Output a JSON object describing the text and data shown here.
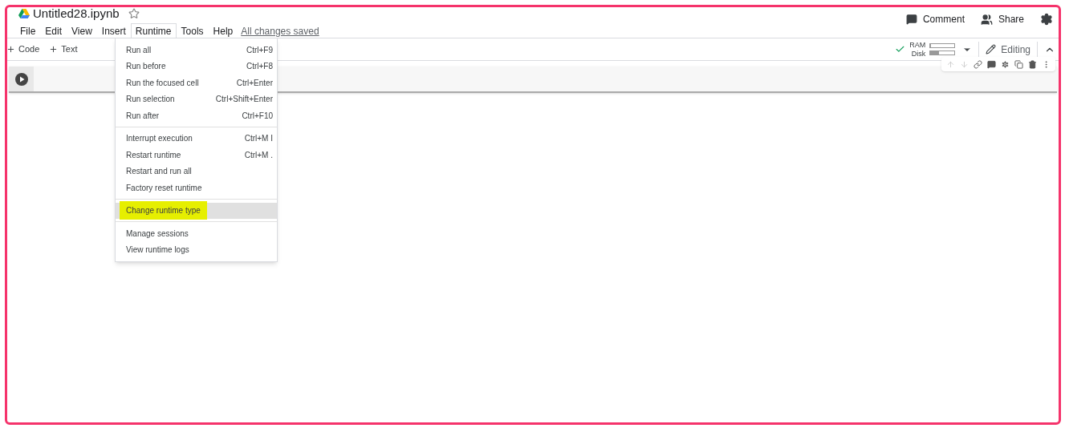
{
  "notebook": {
    "title": "Untitled28.ipynb",
    "starred": false
  },
  "menubar": [
    {
      "label": "File",
      "selected": false
    },
    {
      "label": "Edit",
      "selected": false
    },
    {
      "label": "View",
      "selected": false
    },
    {
      "label": "Insert",
      "selected": false
    },
    {
      "label": "Runtime",
      "selected": true
    },
    {
      "label": "Tools",
      "selected": false
    },
    {
      "label": "Help",
      "selected": false
    }
  ],
  "save_status": "All changes saved",
  "header_actions": [
    "Comment",
    "Share"
  ],
  "toolbar": {
    "add_buttons": [
      "Code",
      "Text"
    ],
    "resources": [
      {
        "label": "RAM",
        "level": 0.02
      },
      {
        "label": "Disk",
        "level": 0.35
      }
    ],
    "mode": "Editing"
  },
  "runtime_menu": {
    "groups": [
      [
        {
          "label": "Run all",
          "shortcut": "Ctrl+F9",
          "highlighted": false
        },
        {
          "label": "Run before",
          "shortcut": "Ctrl+F8",
          "highlighted": false
        },
        {
          "label": "Run the focused cell",
          "shortcut": "Ctrl+Enter",
          "highlighted": false
        },
        {
          "label": "Run selection",
          "shortcut": "Ctrl+Shift+Enter",
          "highlighted": false
        },
        {
          "label": "Run after",
          "shortcut": "Ctrl+F10",
          "highlighted": false
        }
      ],
      [
        {
          "label": "Interrupt execution",
          "shortcut": "Ctrl+M I",
          "highlighted": false
        },
        {
          "label": "Restart runtime",
          "shortcut": "Ctrl+M .",
          "highlighted": false
        },
        {
          "label": "Restart and run all",
          "highlighted": false
        },
        {
          "label": "Factory reset runtime",
          "highlighted": false
        }
      ],
      [
        {
          "label": "Change runtime type",
          "highlighted": true
        }
      ],
      [
        {
          "label": "Manage sessions",
          "highlighted": false
        },
        {
          "label": "View runtime logs",
          "highlighted": false
        }
      ]
    ]
  }
}
